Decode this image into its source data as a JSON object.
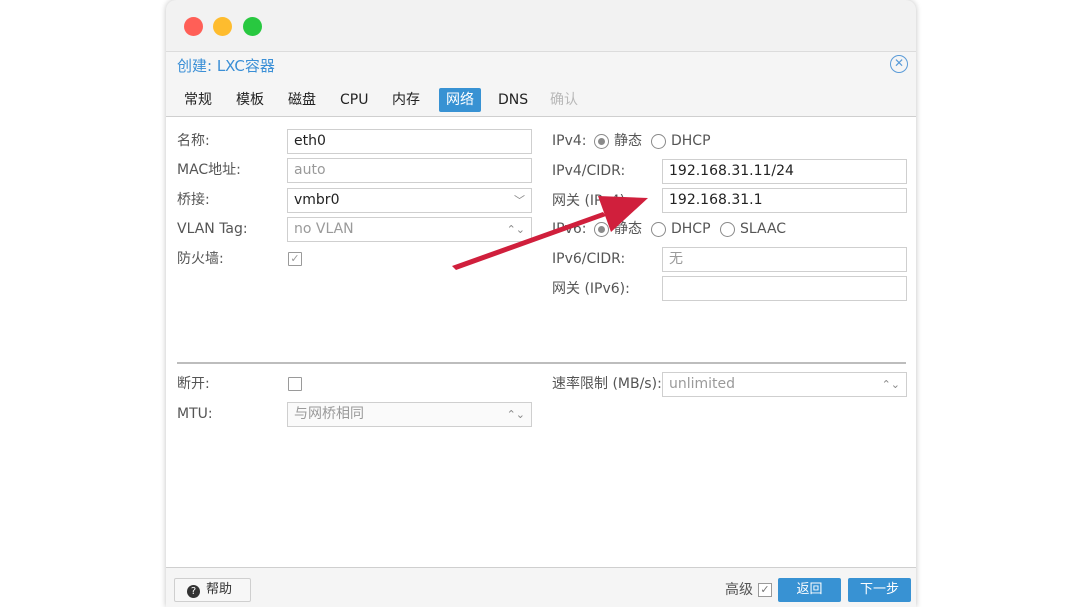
{
  "dialog": {
    "title": "创建: LXC容器",
    "close_icon": "close-icon"
  },
  "tabs": [
    {
      "label": "常规",
      "state": "normal"
    },
    {
      "label": "模板",
      "state": "normal"
    },
    {
      "label": "磁盘",
      "state": "normal"
    },
    {
      "label": "CPU",
      "state": "normal"
    },
    {
      "label": "内存",
      "state": "normal"
    },
    {
      "label": "网络",
      "state": "active"
    },
    {
      "label": "DNS",
      "state": "normal"
    },
    {
      "label": "确认",
      "state": "disabled"
    }
  ],
  "left": {
    "name_label": "名称:",
    "name_value": "eth0",
    "mac_label": "MAC地址:",
    "mac_placeholder": "auto",
    "bridge_label": "桥接:",
    "bridge_value": "vmbr0",
    "vlan_label": "VLAN Tag:",
    "vlan_placeholder": "no VLAN",
    "firewall_label": "防火墙:",
    "firewall_checked": true
  },
  "right": {
    "ipv4_label": "IPv4:",
    "ipv4_static": "静态",
    "ipv4_dhcp": "DHCP",
    "ipv4_mode": "static",
    "ipv4_cidr_label": "IPv4/CIDR:",
    "ipv4_cidr_value": "192.168.31.11/24",
    "gw4_label": "网关 (IPv4):",
    "gw4_value": "192.168.31.1",
    "ipv6_label": "IPv6:",
    "ipv6_static": "静态",
    "ipv6_dhcp": "DHCP",
    "ipv6_slaac": "SLAAC",
    "ipv6_mode": "static",
    "ipv6_cidr_label": "IPv6/CIDR:",
    "ipv6_cidr_placeholder": "无",
    "gw6_label": "网关 (IPv6):",
    "gw6_value": ""
  },
  "advanced": {
    "disconnect_label": "断开:",
    "disconnect_checked": false,
    "mtu_label": "MTU:",
    "mtu_placeholder": "与网桥相同",
    "rate_label": "速率限制 (MB/s):",
    "rate_placeholder": "unlimited"
  },
  "footer": {
    "help_label": "帮助",
    "advanced_label": "高级",
    "advanced_checked": true,
    "back_label": "返回",
    "next_label": "下一步"
  },
  "colors": {
    "accent": "#3892d3",
    "arrow": "#d01f3c"
  }
}
